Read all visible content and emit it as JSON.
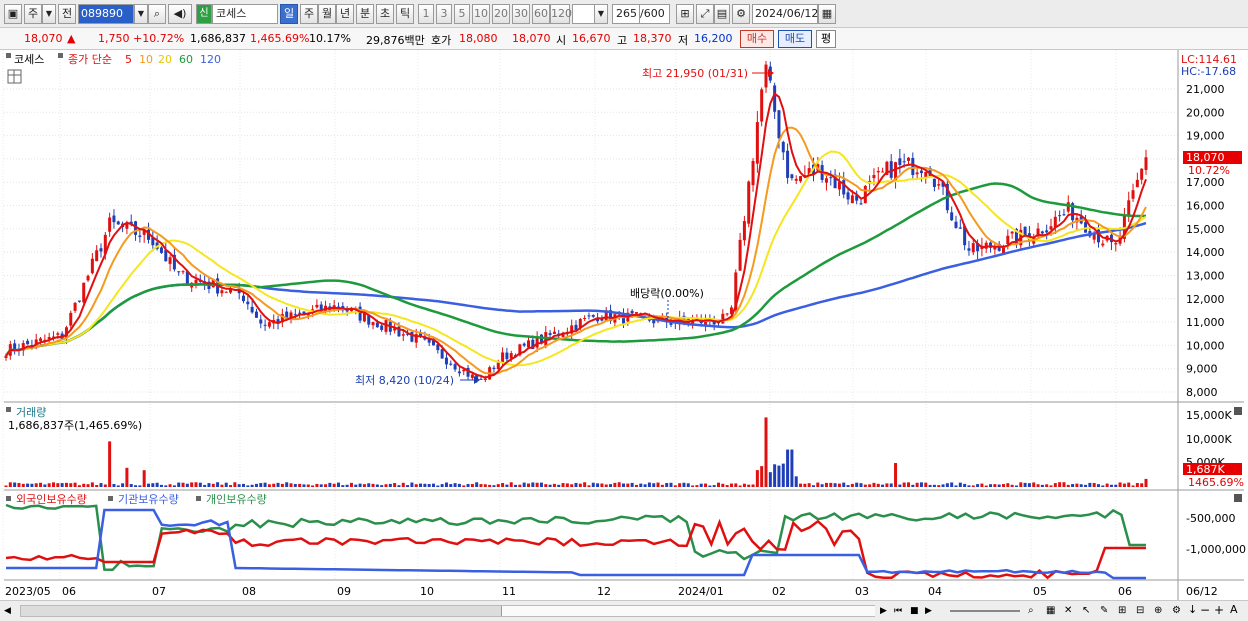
{
  "toolbar": {
    "type_label": "주",
    "prev_label": "전",
    "code_value": "089890",
    "market_badge": "신",
    "stock_name": "코세스",
    "periods": [
      "일",
      "주",
      "월",
      "년",
      "분",
      "초",
      "틱"
    ],
    "active_period": "일",
    "intervals": [
      "1",
      "3",
      "5",
      "10",
      "20",
      "30",
      "60",
      "120"
    ],
    "count_value": "265",
    "count_max": "/600",
    "date_value": "2024/06/12"
  },
  "info": {
    "price": "18,070",
    "change_arrow": "▲",
    "change": "1,750",
    "change_pct": "+10.72%",
    "volume": "1,686,837",
    "volume_ratio": "1,465.69%",
    "turnover": "10.17%",
    "amount": "29,876백만",
    "quote_label": "호가",
    "ask": "18,080",
    "bid": "18,070",
    "open_label": "시",
    "open": "16,670",
    "high_label": "고",
    "high": "18,370",
    "low_label": "저",
    "low": "16,200",
    "buy_label": "매수",
    "sell_label": "매도",
    "avg_label": "평"
  },
  "price_panel": {
    "name": "코세스",
    "legend_type": "종가 단순",
    "ma_periods": [
      "5",
      "10",
      "20",
      "60",
      "120"
    ],
    "ma_colors": [
      "#e01010",
      "#f59a1e",
      "#f5e61e",
      "#1d9a3c",
      "#3a5fe0"
    ],
    "lc_label": "LC:114.61",
    "hc_label": "HC:-17.68",
    "y_ticks": [
      "21,000",
      "20,000",
      "19,000",
      "18,000",
      "17,000",
      "16,000",
      "15,000",
      "14,000",
      "13,000",
      "12,000",
      "11,000",
      "10,000",
      "9,000",
      "8,000"
    ],
    "high_annotation": "최고 21,950 (01/31)",
    "low_annotation": "최저 8,420 (10/24)",
    "dividend_annotation": "배당락(0.00%)",
    "last_price_tag": "18,070",
    "last_pct_tag": "10.72%"
  },
  "volume_panel": {
    "title": "거래량",
    "current": "1,686,837주(1,465.69%)",
    "y_ticks": [
      "15,000K",
      "10,000K",
      "5,000K"
    ],
    "last_tag": "1,687K",
    "last_pct": "1465.69%"
  },
  "holding_panel": {
    "series": [
      "외국인보유수량",
      "기관보유수량",
      "개인보유수량"
    ],
    "colors": [
      "#e01010",
      "#3a5fe0",
      "#2a8f4a"
    ],
    "y_ticks": [
      "-500,000",
      "-1,000,000"
    ]
  },
  "x_axis": {
    "labels": [
      "2023/05",
      "06",
      "07",
      "08",
      "09",
      "10",
      "11",
      "12",
      "2024/01",
      "02",
      "03",
      "04",
      "05",
      "06"
    ],
    "end_label": "06/12"
  },
  "chart_data": {
    "type": "candlestick",
    "title": "코세스",
    "x_range": [
      "2023/05",
      "2024/06/12"
    ],
    "price_ylim": [
      7500,
      22500
    ],
    "price_anchors": [
      {
        "date": "2023/05",
        "close": 9800
      },
      {
        "date": "2023/06",
        "close": 10400
      },
      {
        "date": "2023/06 late",
        "close": 15200
      },
      {
        "date": "2023/07",
        "close": 14600
      },
      {
        "date": "2023/07 mid",
        "close": 13000
      },
      {
        "date": "2023/08",
        "close": 12200
      },
      {
        "date": "2023/08 mid",
        "close": 10900
      },
      {
        "date": "2023/09",
        "close": 11700
      },
      {
        "date": "2023/10",
        "close": 10200
      },
      {
        "date": "2023/10/24",
        "close": 8420
      },
      {
        "date": "2023/11",
        "close": 9500
      },
      {
        "date": "2023/12",
        "close": 11300
      },
      {
        "date": "2024/01",
        "close": 11000
      },
      {
        "date": "2024/01 mid",
        "close": 11100
      },
      {
        "date": "2024/01/31",
        "close": 21950
      },
      {
        "date": "2024/02",
        "close": 17000
      },
      {
        "date": "2024/02 mid",
        "close": 17600
      },
      {
        "date": "2024/03",
        "close": 16200
      },
      {
        "date": "2024/03 mid",
        "close": 17600
      },
      {
        "date": "2024/04",
        "close": 17800
      },
      {
        "date": "2024/04 mid",
        "close": 14000
      },
      {
        "date": "2024/05",
        "close": 14800
      },
      {
        "date": "2024/05 mid",
        "close": 15800
      },
      {
        "date": "2024/06",
        "close": 14100
      },
      {
        "date": "2024/06/12",
        "close": 18070
      }
    ],
    "volume_spikes": [
      {
        "date": "2023/06 late",
        "volume_k": 9500
      },
      {
        "date": "2024/01/31",
        "volume_k": 14500
      },
      {
        "date": "2024/02",
        "volume_k": 7800
      },
      {
        "date": "2024/03 mid",
        "volume_k": 5000
      },
      {
        "date": "2024/06/12",
        "volume_k": 1687
      }
    ]
  }
}
